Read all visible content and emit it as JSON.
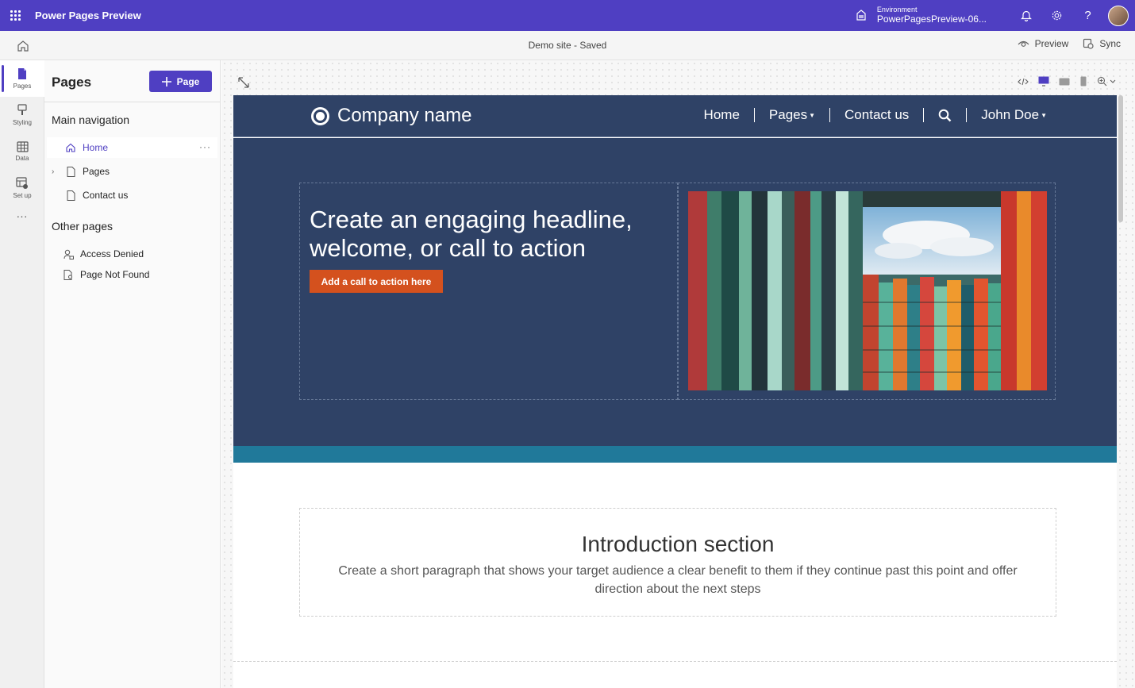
{
  "app": {
    "title": "Power Pages Preview",
    "environment_label": "Environment",
    "environment_value": "PowerPagesPreview-06..."
  },
  "command_bar": {
    "site_status": "Demo site - Saved",
    "preview_label": "Preview",
    "sync_label": "Sync"
  },
  "rail": {
    "items": [
      {
        "label": "Pages",
        "icon": "page-icon"
      },
      {
        "label": "Styling",
        "icon": "paint-brush-icon"
      },
      {
        "label": "Data",
        "icon": "table-icon"
      },
      {
        "label": "Set up",
        "icon": "settings-table-icon"
      }
    ],
    "more": "···"
  },
  "panel": {
    "title": "Pages",
    "add_button": "Page",
    "main_nav_title": "Main navigation",
    "main_nav": [
      {
        "label": "Home",
        "icon": "home-icon"
      },
      {
        "label": "Pages",
        "icon": "document-icon"
      },
      {
        "label": "Contact us",
        "icon": "document-icon"
      }
    ],
    "item_more": "···",
    "other_pages_title": "Other pages",
    "other_pages": [
      {
        "label": "Access Denied",
        "icon": "person-lock-icon"
      },
      {
        "label": "Page Not Found",
        "icon": "document-search-icon"
      }
    ]
  },
  "site": {
    "company_name": "Company name",
    "nav": {
      "home": "Home",
      "pages": "Pages",
      "contact": "Contact us",
      "user": "John Doe"
    },
    "hero": {
      "headline": "Create an engaging headline, welcome, or call to action",
      "cta": "Add a call to action here"
    },
    "intro": {
      "title": "Introduction section",
      "text": "Create a short paragraph that shows your target audience a clear benefit to them if they continue past this point and offer direction about the next steps"
    }
  },
  "colors": {
    "brand": "#4f3fc2",
    "site_header": "#2f4266",
    "cta": "#d4511e",
    "stripe": "#20799a"
  }
}
